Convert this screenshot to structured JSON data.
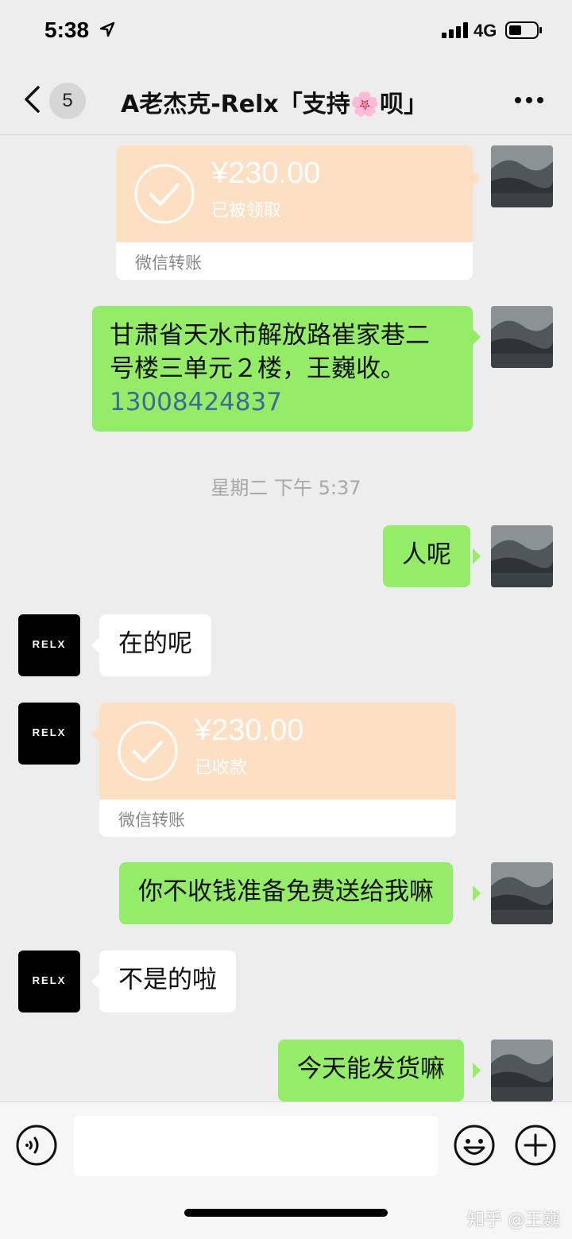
{
  "status_bar": {
    "time": "5:38",
    "network": "4G"
  },
  "nav": {
    "unread_count": "5",
    "title": "A老杰克-Relx「支持🌸呗」"
  },
  "messages": [
    {
      "type": "transfer",
      "side": "right",
      "amount": "¥230.00",
      "status": "已被领取",
      "footer": "微信转账"
    },
    {
      "type": "text",
      "side": "right",
      "line1": "甘肃省天水市解放路崔家巷二",
      "line2": "号楼三单元２楼，王巍收。",
      "phone": "13008424837"
    },
    {
      "type": "timestamp",
      "text": "星期二 下午 5:37"
    },
    {
      "type": "text",
      "side": "right",
      "text": "人呢"
    },
    {
      "type": "text",
      "side": "left",
      "text": "在的呢"
    },
    {
      "type": "transfer",
      "side": "left",
      "amount": "¥230.00",
      "status": "已收款",
      "footer": "微信转账"
    },
    {
      "type": "text",
      "side": "right",
      "text": "你不收钱准备免费送给我嘛"
    },
    {
      "type": "text",
      "side": "left",
      "text": "不是的啦"
    },
    {
      "type": "text",
      "side": "right",
      "text": "今天能发货嘛"
    }
  ],
  "avatar_relx": {
    "logo_text": "RELX"
  },
  "watermark": "知乎 @王巍",
  "colors": {
    "green_bubble": "#95ec69",
    "transfer_bg": "#fde0c3",
    "background": "#ededed"
  }
}
